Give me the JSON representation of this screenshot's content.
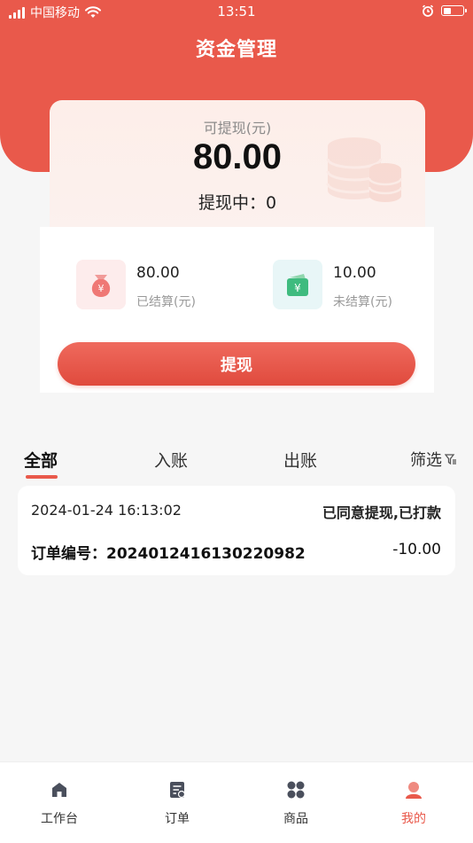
{
  "status_bar": {
    "carrier": "中国移动",
    "time": "13:51"
  },
  "header": {
    "title": "资金管理"
  },
  "balance": {
    "label": "可提现(元)",
    "amount": "80.00",
    "pending": "提现中：0"
  },
  "stats": [
    {
      "value": "80.00",
      "label": "已结算(元)",
      "icon": "money-bag-icon",
      "bg": "#fdecec",
      "color": "#ef6f6f"
    },
    {
      "value": "10.00",
      "label": "未结算(元)",
      "icon": "wallet-icon",
      "bg": "#e8f6f7",
      "color": "#3dbb7f"
    }
  ],
  "withdraw_button": "提现",
  "tabs": {
    "all": "全部",
    "income": "入账",
    "expense": "出账",
    "filter": "筛选"
  },
  "records": [
    {
      "date": "2024-01-24 16:13:02",
      "status": "已同意提现,已打款",
      "order_label": "订单编号：",
      "order_no": "20240124161302209​82",
      "amount": "-10.00"
    }
  ],
  "tabbar": [
    {
      "label": "工作台",
      "icon": "workbench-icon"
    },
    {
      "label": "订单",
      "icon": "order-icon"
    },
    {
      "label": "商品",
      "icon": "goods-icon"
    },
    {
      "label": "我的",
      "icon": "profile-icon"
    }
  ],
  "colors": {
    "primary": "#e9594b",
    "background": "#f6f6f6"
  }
}
